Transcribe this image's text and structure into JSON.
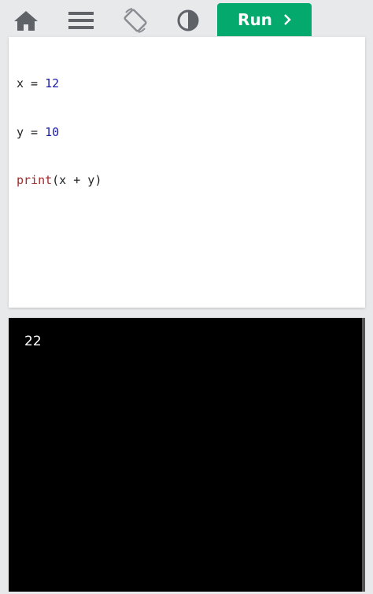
{
  "toolbar": {
    "icons": [
      "home-icon",
      "menu-icon",
      "rotate-icon",
      "contrast-icon"
    ],
    "run_label": "Run",
    "run_color": "#04aa6d"
  },
  "editor": {
    "line1": {
      "var": "x",
      "op": " = ",
      "num": "12"
    },
    "line2": {
      "var": "y",
      "op": " = ",
      "num": "10"
    },
    "line3": {
      "fn": "print",
      "args": "(x + y)"
    }
  },
  "output": {
    "text": "22"
  }
}
